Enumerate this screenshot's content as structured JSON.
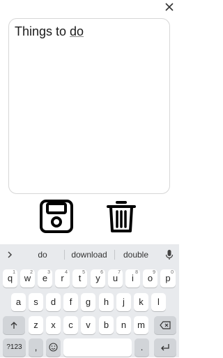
{
  "note": {
    "text_prefix": "Things to ",
    "text_underlined": "do"
  },
  "suggestions": [
    "do",
    "download",
    "double"
  ],
  "keyboard": {
    "row1": [
      {
        "k": "q",
        "h": "1"
      },
      {
        "k": "w",
        "h": "2"
      },
      {
        "k": "e",
        "h": "3"
      },
      {
        "k": "r",
        "h": "4"
      },
      {
        "k": "t",
        "h": "5"
      },
      {
        "k": "y",
        "h": "6"
      },
      {
        "k": "u",
        "h": "7"
      },
      {
        "k": "i",
        "h": "8"
      },
      {
        "k": "o",
        "h": "9"
      },
      {
        "k": "p",
        "h": "0"
      }
    ],
    "row2": [
      "a",
      "s",
      "d",
      "f",
      "g",
      "h",
      "j",
      "k",
      "l"
    ],
    "row3": [
      "z",
      "x",
      "c",
      "v",
      "b",
      "n",
      "m"
    ],
    "sym_label": "?123",
    "comma": ",",
    "period": "."
  },
  "icons": {
    "close": "close-icon",
    "save": "floppy-disk-icon",
    "delete": "trash-icon",
    "chevron": "chevron-right-icon",
    "mic": "microphone-icon",
    "shift": "shift-icon",
    "backspace": "backspace-icon",
    "emoji": "emoji-icon",
    "enter": "enter-icon"
  }
}
